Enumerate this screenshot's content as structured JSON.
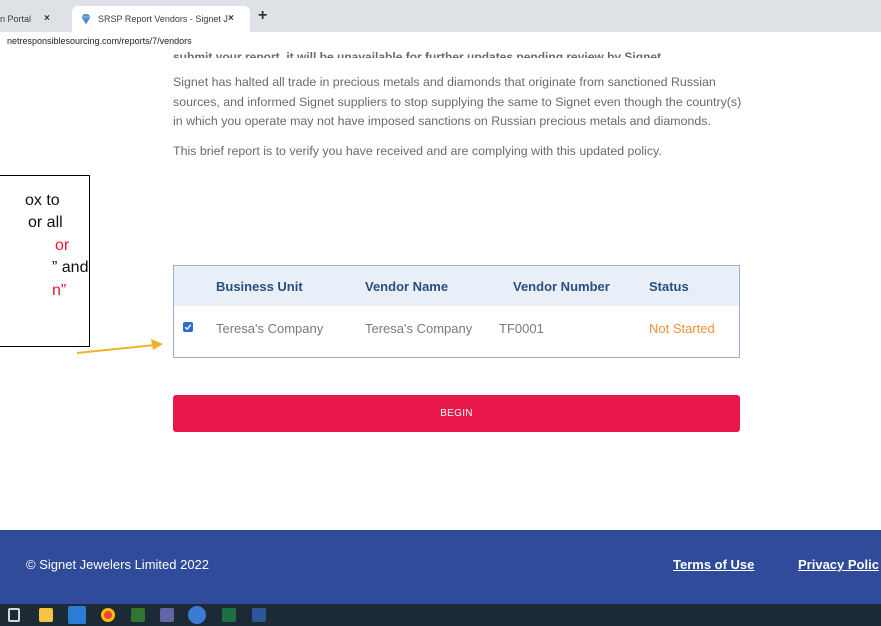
{
  "browser": {
    "tabs": [
      {
        "label": "n Portal"
      },
      {
        "label": "SRSP Report Vendors - Signet Jew"
      }
    ],
    "tab_close": "×",
    "new_tab": "+",
    "url": "netresponsiblesourcing.com/reports/7/vendors"
  },
  "page": {
    "cut_line": "submit your report, it will be unavailable for further updates pending review by Signet.",
    "paragraph1": "Signet has halted all trade in precious metals and diamonds that originate from sanctioned Russian sources, and informed Signet suppliers to stop supplying the same to Signet even though the country(s) in which you operate may not have imposed sanctions on Russian precious metals and diamonds.",
    "paragraph2": "This brief report is to verify you have received and are complying with this updated policy."
  },
  "table": {
    "headers": [
      "Business Unit",
      "Vendor Name",
      "Vendor Number",
      "Status"
    ],
    "rows": [
      {
        "checked": true,
        "business_unit": "Teresa's Company",
        "vendor_name": "Teresa's Company",
        "vendor_number": "TF0001",
        "status": "Not Started"
      }
    ]
  },
  "begin_button": "BEGIN",
  "callout": {
    "lines": [
      "ox to",
      " or all",
      "or",
      "” and",
      "n”"
    ],
    "accent_color": "#e8152b",
    "arrow_color": "#f2b12a"
  },
  "footer": {
    "copyright": "© Signet Jewelers Limited 2022",
    "terms": "Terms of Use",
    "privacy": "Privacy Polic"
  },
  "colors": {
    "footer_bg": "#2f4b9a",
    "begin_bg": "#e8184a",
    "header_text": "#2b4e7d",
    "status_text": "#e8913a"
  },
  "taskbar_icons": [
    "task-view-icon",
    "file-explorer-icon",
    "outlook-icon",
    "chrome-icon",
    "project-icon",
    "teams-icon",
    "edge-icon",
    "excel-icon",
    "word-icon"
  ]
}
